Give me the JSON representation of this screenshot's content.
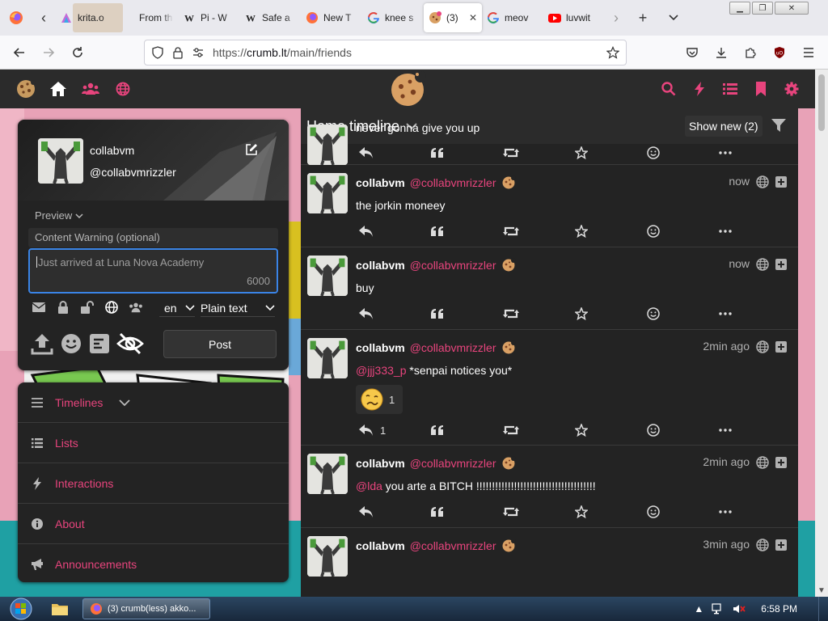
{
  "browser": {
    "tabs": [
      {
        "title": "krita.o",
        "favicon": "krita-icon",
        "color": "#7a5ab5"
      },
      {
        "title": "From the",
        "favicon": "blank-icon",
        "color": "#e9e9ee"
      },
      {
        "title": "Pi - W",
        "favicon": "wikipedia-icon",
        "color": "#ffffff"
      },
      {
        "title": "Safe a",
        "favicon": "wikipedia-icon",
        "color": "#ffffff"
      },
      {
        "title": "New T",
        "favicon": "firefox-icon",
        "color": "#ff7139"
      },
      {
        "title": "knee s",
        "favicon": "google-icon",
        "color": "#ffffff"
      },
      {
        "title": "(3)",
        "favicon": "crumb-icon",
        "color": "#e8447d",
        "active": true
      },
      {
        "title": "meov",
        "favicon": "google-icon",
        "color": "#ffffff"
      },
      {
        "title": "luvwit",
        "favicon": "youtube-icon",
        "color": "#ff0000"
      }
    ],
    "url_scheme": "https://",
    "url_domain": "crumb.lt",
    "url_path": "/main/friends",
    "new_tab_symbol": "+",
    "close_symbol": "✕"
  },
  "site": {
    "accent": "#e8447d",
    "header_bg": "#2b2b2b",
    "panel_bg": "#232323"
  },
  "post_form": {
    "user_name": "collabvm",
    "user_handle": "@collabvmrizzler",
    "preview_label": "Preview",
    "cw_placeholder": "Content Warning (optional)",
    "text_value": "Just arrived at Luna Nova Academy",
    "char_count": "6000",
    "language": "en",
    "format": "Plain text",
    "post_label": "Post"
  },
  "nav": {
    "items": [
      {
        "label": "Timelines",
        "icon": "bars-icon"
      },
      {
        "label": "Lists",
        "icon": "list-icon"
      },
      {
        "label": "Interactions",
        "icon": "bolt-icon"
      },
      {
        "label": "About",
        "icon": "info-icon"
      },
      {
        "label": "Announcements",
        "icon": "bullhorn-icon"
      }
    ]
  },
  "timeline": {
    "title": "Home timeline",
    "show_new": "Show new (2)",
    "statuses": [
      {
        "name": "",
        "handle": "",
        "time": "",
        "text": "never gonna give you up",
        "reply_count": ""
      },
      {
        "name": "collabvm",
        "handle": "@collabvmrizzler",
        "time": "now",
        "text": "the jorkin moneey",
        "reply_count": ""
      },
      {
        "name": "collabvm",
        "handle": "@collabvmrizzler",
        "time": "now",
        "text": "buy",
        "reply_count": ""
      },
      {
        "name": "collabvm",
        "handle": "@collabvmrizzler",
        "time": "2min ago",
        "mention": "@jjj333_p",
        "text": "*senpai notices you*",
        "reaction_count": "1",
        "reply_count": "1"
      },
      {
        "name": "collabvm",
        "handle": "@collabvmrizzler",
        "time": "2min ago",
        "mention": "@lda",
        "text": "you arte a BITCH !!!!!!!!!!!!!!!!!!!!!!!!!!!!!!!!!!!!!!",
        "reply_count": ""
      },
      {
        "name": "collabvm",
        "handle": "@collabvmrizzler",
        "time": "3min ago",
        "text": "",
        "reply_count": ""
      }
    ]
  },
  "taskbar": {
    "firefox_title": "(3) crumb(less) akko...",
    "clock": "6:58 PM"
  }
}
